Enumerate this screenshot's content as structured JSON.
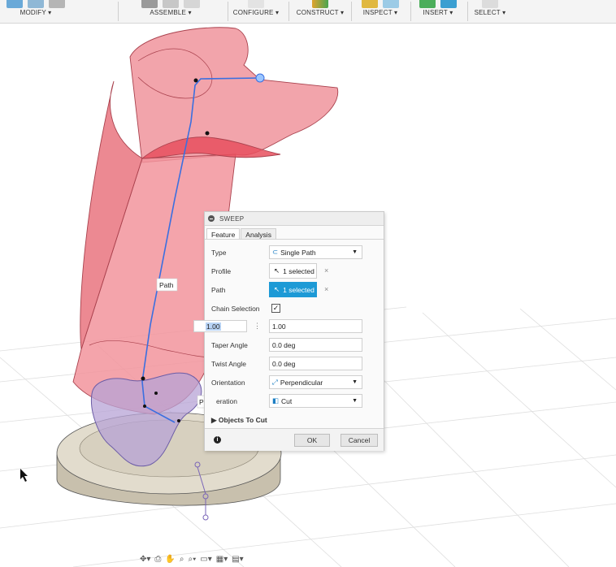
{
  "toolbar": {
    "groups": [
      {
        "label": "MODIFY ▾"
      },
      {
        "label": "ASSEMBLE ▾"
      },
      {
        "label": "CONFIGURE ▾"
      },
      {
        "label": "CONSTRUCT ▾"
      },
      {
        "label": "INSPECT ▾"
      },
      {
        "label": "INSERT ▾"
      },
      {
        "label": "SELECT ▾"
      }
    ]
  },
  "viewport": {
    "labels": {
      "path": "Path",
      "profile": "Profile"
    },
    "colors": {
      "body": "#f1939b",
      "body_edge": "#b2404c",
      "path": "#3a6fe0",
      "profile": "#b7a3d6",
      "base": "#d9d3c5",
      "grid": "#dcdcdc"
    }
  },
  "sweep_dialog": {
    "title": "SWEEP",
    "tabs": [
      "Feature",
      "Analysis"
    ],
    "type": {
      "label": "Type",
      "value": "Single Path"
    },
    "profile": {
      "label": "Profile",
      "value": "1 selected"
    },
    "path": {
      "label": "Path",
      "value": "1 selected"
    },
    "chain_selection": {
      "label": "Chain Selection",
      "checked": true,
      "mark": "✓"
    },
    "distance": {
      "inline_value": "1.00",
      "value": "1.00"
    },
    "taper_angle": {
      "label": "Taper Angle",
      "value": "0.0 deg"
    },
    "twist_angle": {
      "label": "Twist Angle",
      "value": "0.0 deg"
    },
    "orientation": {
      "label": "Orientation",
      "value": "Perpendicular"
    },
    "operation": {
      "label": "eration",
      "value": "Cut"
    },
    "objects_to_cut": "Objects To Cut",
    "ok": "OK",
    "cancel": "Cancel",
    "clear": "×"
  }
}
